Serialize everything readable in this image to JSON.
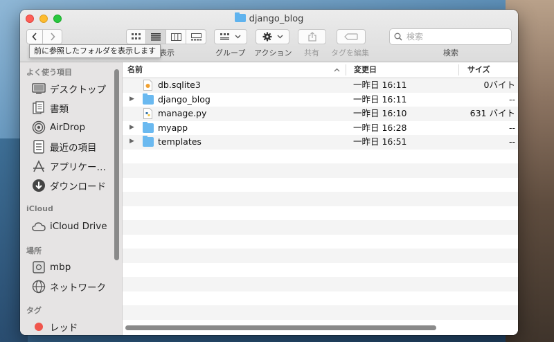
{
  "window": {
    "title": "django_blog"
  },
  "toolbar": {
    "tooltip": "前に参照したフォルダを表示します",
    "view_label": "表示",
    "group_label": "グループ",
    "action_label": "アクション",
    "share_label": "共有",
    "tag_edit_label": "タグを編集",
    "search_label": "検索",
    "search_placeholder": "検索"
  },
  "sidebar": {
    "favorites_header": "よく使う項目",
    "favorites": [
      {
        "label": "デスクトップ",
        "icon": "desktop-icon"
      },
      {
        "label": "書類",
        "icon": "documents-icon"
      },
      {
        "label": "AirDrop",
        "icon": "airdrop-icon"
      },
      {
        "label": "最近の項目",
        "icon": "recents-icon"
      },
      {
        "label": "アプリケー…",
        "icon": "applications-icon"
      },
      {
        "label": "ダウンロード",
        "icon": "downloads-icon"
      }
    ],
    "icloud_header": "iCloud",
    "icloud": [
      {
        "label": "iCloud Drive",
        "icon": "cloud-icon"
      }
    ],
    "places_header": "場所",
    "places": [
      {
        "label": "mbp",
        "icon": "disk-icon"
      },
      {
        "label": "ネットワーク",
        "icon": "network-icon"
      }
    ],
    "tags_header": "タグ",
    "tags": [
      {
        "label": "レッド",
        "color": "#f0554c"
      }
    ]
  },
  "columns": {
    "name": "名前",
    "modified": "変更日",
    "size": "サイズ"
  },
  "files": [
    {
      "name": "db.sqlite3",
      "modified": "一昨日 16:11",
      "size": "0バイト",
      "kind": "document",
      "expandable": false
    },
    {
      "name": "django_blog",
      "modified": "一昨日 16:11",
      "size": "--",
      "kind": "folder",
      "expandable": true
    },
    {
      "name": "manage.py",
      "modified": "一昨日 16:10",
      "size": "631 バイト",
      "kind": "python",
      "expandable": false
    },
    {
      "name": "myapp",
      "modified": "一昨日 16:28",
      "size": "--",
      "kind": "folder",
      "expandable": true
    },
    {
      "name": "templates",
      "modified": "一昨日 16:51",
      "size": "--",
      "kind": "folder",
      "expandable": true
    }
  ]
}
